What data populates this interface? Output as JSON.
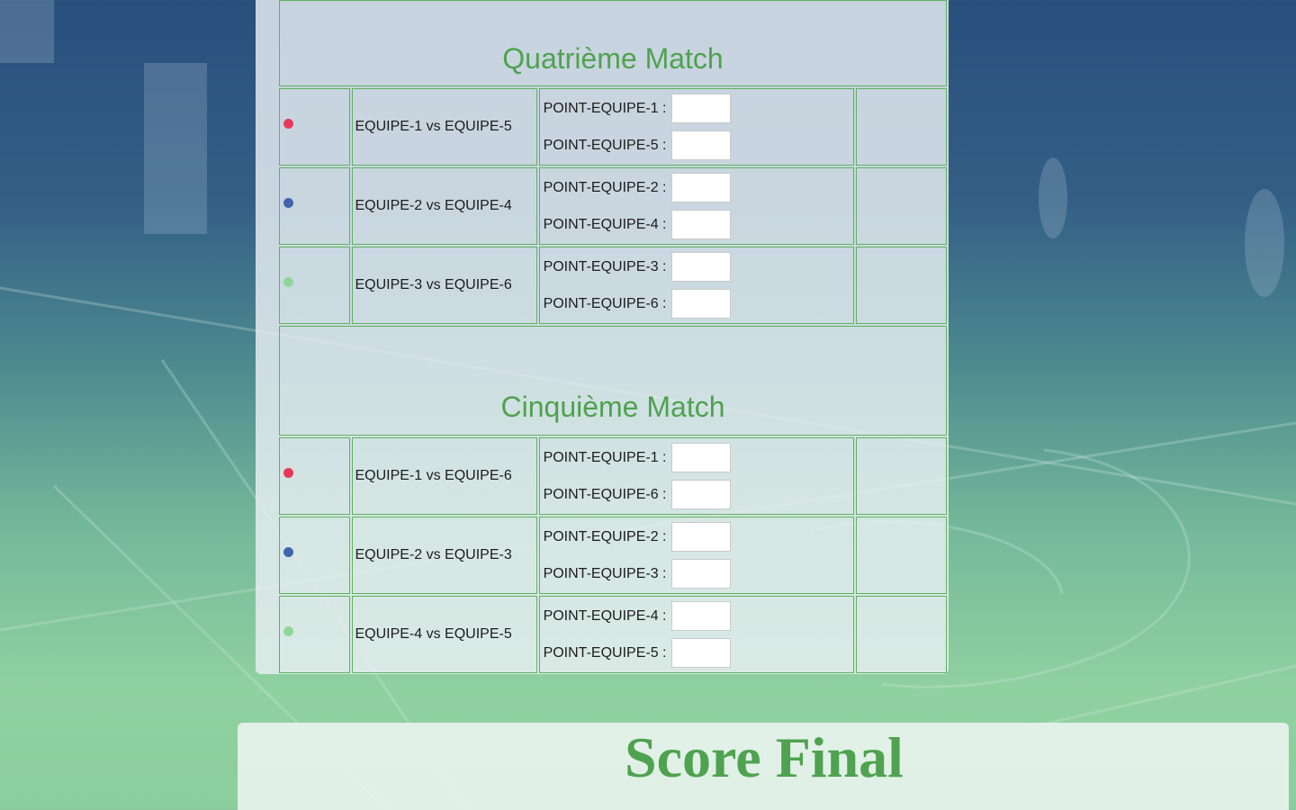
{
  "colors": {
    "accent_green": "#4fa24f",
    "border_green": "#5fb25f",
    "dot_red": "#e8385a",
    "dot_blue": "#3f66ad",
    "dot_lightgreen": "#8fd69a"
  },
  "sections": [
    {
      "title": "Quatrième Match",
      "rows": [
        {
          "dot_color": "#e8385a",
          "matchup": "EQUIPE-1 vs EQUIPE-5",
          "points": [
            {
              "label": "POINT-EQUIPE-1 :",
              "value": ""
            },
            {
              "label": "POINT-EQUIPE-5 :",
              "value": ""
            }
          ]
        },
        {
          "dot_color": "#3f66ad",
          "matchup": "EQUIPE-2 vs EQUIPE-4",
          "points": [
            {
              "label": "POINT-EQUIPE-2 :",
              "value": ""
            },
            {
              "label": "POINT-EQUIPE-4 :",
              "value": ""
            }
          ]
        },
        {
          "dot_color": "#8fd69a",
          "matchup": "EQUIPE-3 vs EQUIPE-6",
          "points": [
            {
              "label": "POINT-EQUIPE-3 :",
              "value": ""
            },
            {
              "label": "POINT-EQUIPE-6 :",
              "value": ""
            }
          ]
        }
      ]
    },
    {
      "title": "Cinquième Match",
      "rows": [
        {
          "dot_color": "#e8385a",
          "matchup": "EQUIPE-1 vs EQUIPE-6",
          "points": [
            {
              "label": "POINT-EQUIPE-1 :",
              "value": ""
            },
            {
              "label": "POINT-EQUIPE-6 :",
              "value": ""
            }
          ]
        },
        {
          "dot_color": "#3f66ad",
          "matchup": "EQUIPE-2 vs EQUIPE-3",
          "points": [
            {
              "label": "POINT-EQUIPE-2 :",
              "value": ""
            },
            {
              "label": "POINT-EQUIPE-3 :",
              "value": ""
            }
          ]
        },
        {
          "dot_color": "#8fd69a",
          "matchup": "EQUIPE-4 vs EQUIPE-5",
          "points": [
            {
              "label": "POINT-EQUIPE-4 :",
              "value": ""
            },
            {
              "label": "POINT-EQUIPE-5 :",
              "value": ""
            }
          ]
        }
      ]
    }
  ],
  "final": {
    "title": "Score Final"
  }
}
